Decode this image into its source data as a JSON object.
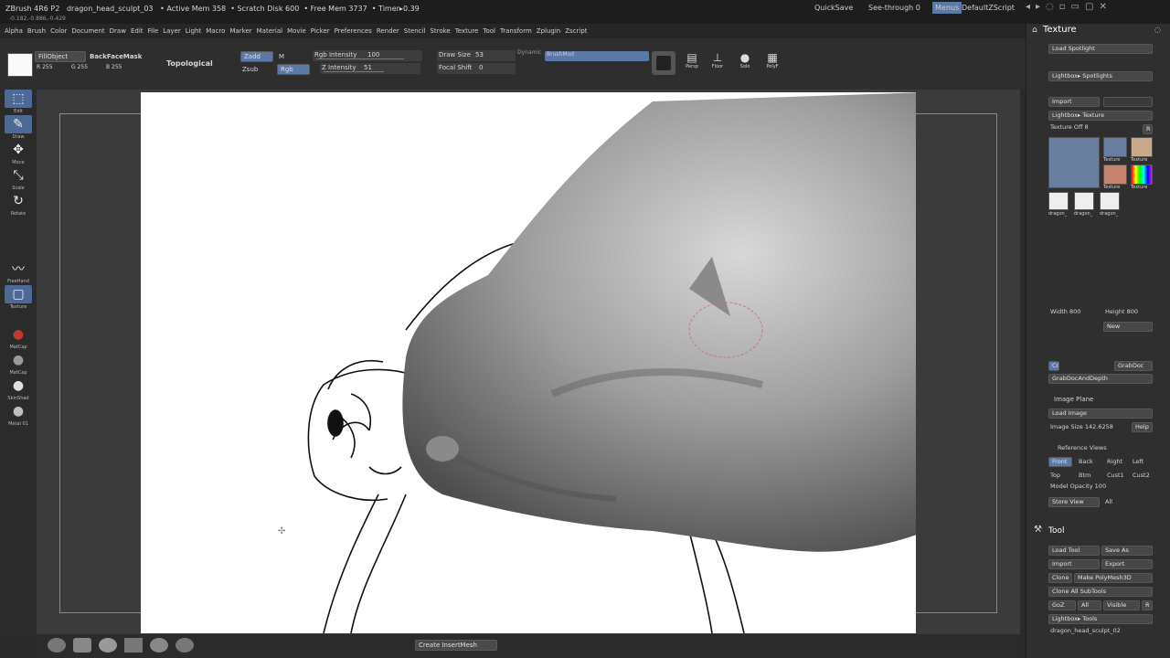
{
  "titlebar": {
    "app": "ZBrush 4R6 P2",
    "document": "dragon_head_sculpt_03",
    "active_mem": "• Active Mem 358",
    "scratch_disk": "• Scratch Disk 600",
    "free_mem": "• Free Mem 3737",
    "timer": "• Timer▸0.39",
    "quicksave": "QuickSave",
    "see_through": "See-through",
    "see_through_value": "0",
    "menus": "Menus",
    "script": "DefaultZScript",
    "coords": "-0.182,-0.886,-0.429"
  },
  "menu": [
    "Alpha",
    "Brush",
    "Color",
    "Document",
    "Draw",
    "Edit",
    "File",
    "Layer",
    "Light",
    "Macro",
    "Marker",
    "Material",
    "Movie",
    "Picker",
    "Preferences",
    "Render",
    "Stencil",
    "Stroke",
    "Texture",
    "Tool",
    "Transform",
    "Zplugin",
    "Zscript"
  ],
  "toolbar": {
    "fill_object": "FillObject",
    "backface_mask": "BackFaceMask",
    "r": "R 255",
    "g": "G 255",
    "b": "B 255",
    "topological": "Topological",
    "zadd": "Zadd",
    "m": "M",
    "zsub": "Zsub",
    "rgb": "Rgb",
    "rgb_intensity": "Rgb Intensity",
    "rgb_intensity_value": "100",
    "z_intensity": "Z Intensity",
    "z_intensity_value": "51",
    "draw_size": "Draw Size",
    "draw_size_value": "53",
    "focal_shift": "Focal Shift",
    "focal_shift_value": "0",
    "dynamic": "Dynamic",
    "brush_mod": "BrushMod",
    "persp": "Persp",
    "floor": "Floor",
    "solo": "Solo",
    "polyf": "PolyF"
  },
  "lefttray": [
    {
      "icon": "edit-icon",
      "label": "Edit"
    },
    {
      "icon": "draw-icon",
      "label": "Draw"
    },
    {
      "icon": "move-icon",
      "label": "Move"
    },
    {
      "icon": "scale-icon",
      "label": "Scale"
    },
    {
      "icon": "rotate-icon",
      "label": "Rotate"
    },
    {
      "icon": "freehand-icon",
      "label": "FreeHand"
    },
    {
      "icon": "texture-icon",
      "label": "Texture"
    },
    {
      "icon": "matcap-icon",
      "label": "MatCap"
    },
    {
      "icon": "matcap-gray-icon",
      "label": "MatCap"
    },
    {
      "icon": "skinshade-icon",
      "label": "SkinShad"
    },
    {
      "icon": "metal-icon",
      "label": "Metal 01"
    }
  ],
  "shelf": {
    "create_insert_mesh": "Create InsertMesh"
  },
  "texture_panel": {
    "title": "Texture",
    "load_spotlight": "Load Spotlight",
    "lightbox_spotlights": "Lightbox▸ Spotlights",
    "import": "Import",
    "lightbox_texture": "Lightbox▸ Texture",
    "texture_off": "Texture Off",
    "texture_off_value": "8",
    "r": "R",
    "thumb_labels": [
      "Texture",
      "Texture",
      "Texture",
      "Texture"
    ],
    "small_labels": [
      "dragon_",
      "dragon_",
      "dragon_"
    ],
    "width_label": "Width",
    "width_value": "800",
    "height_label": "Height",
    "height_value": "800",
    "new": "New",
    "cd": "Cd",
    "grab_doc": "GrabDoc",
    "grab_doc_depth": "GrabDocAndDepth",
    "image_plane": "Image Plane",
    "load_image": "Load Image",
    "image_size_label": "Image Size",
    "image_size_value": "142.6258",
    "help": "Help",
    "reference_views": "Reference Views",
    "views": [
      "Front",
      "Back",
      "Right",
      "Left",
      "Top",
      "Btm",
      "Cust1",
      "Cust2"
    ],
    "model_opacity_label": "Model Opacity",
    "model_opacity_value": "100",
    "store_view": "Store View",
    "all": "All"
  },
  "tool_panel": {
    "title": "Tool",
    "load_tool": "Load Tool",
    "save_as": "Save As",
    "import": "Import",
    "export": "Export",
    "clone": "Clone",
    "make_polymesh": "Make PolyMesh3D",
    "clone_all": "Clone All SubTools",
    "goz": "GoZ",
    "all": "All",
    "visible": "Visible",
    "r": "R",
    "lightbox_tools": "Lightbox▸ Tools",
    "current_tool": "dragon_head_sculpt_02"
  },
  "colors": {
    "accent": "#5b79a8",
    "bg": "#2a2a2a",
    "canvas": "#3b3b3b"
  }
}
